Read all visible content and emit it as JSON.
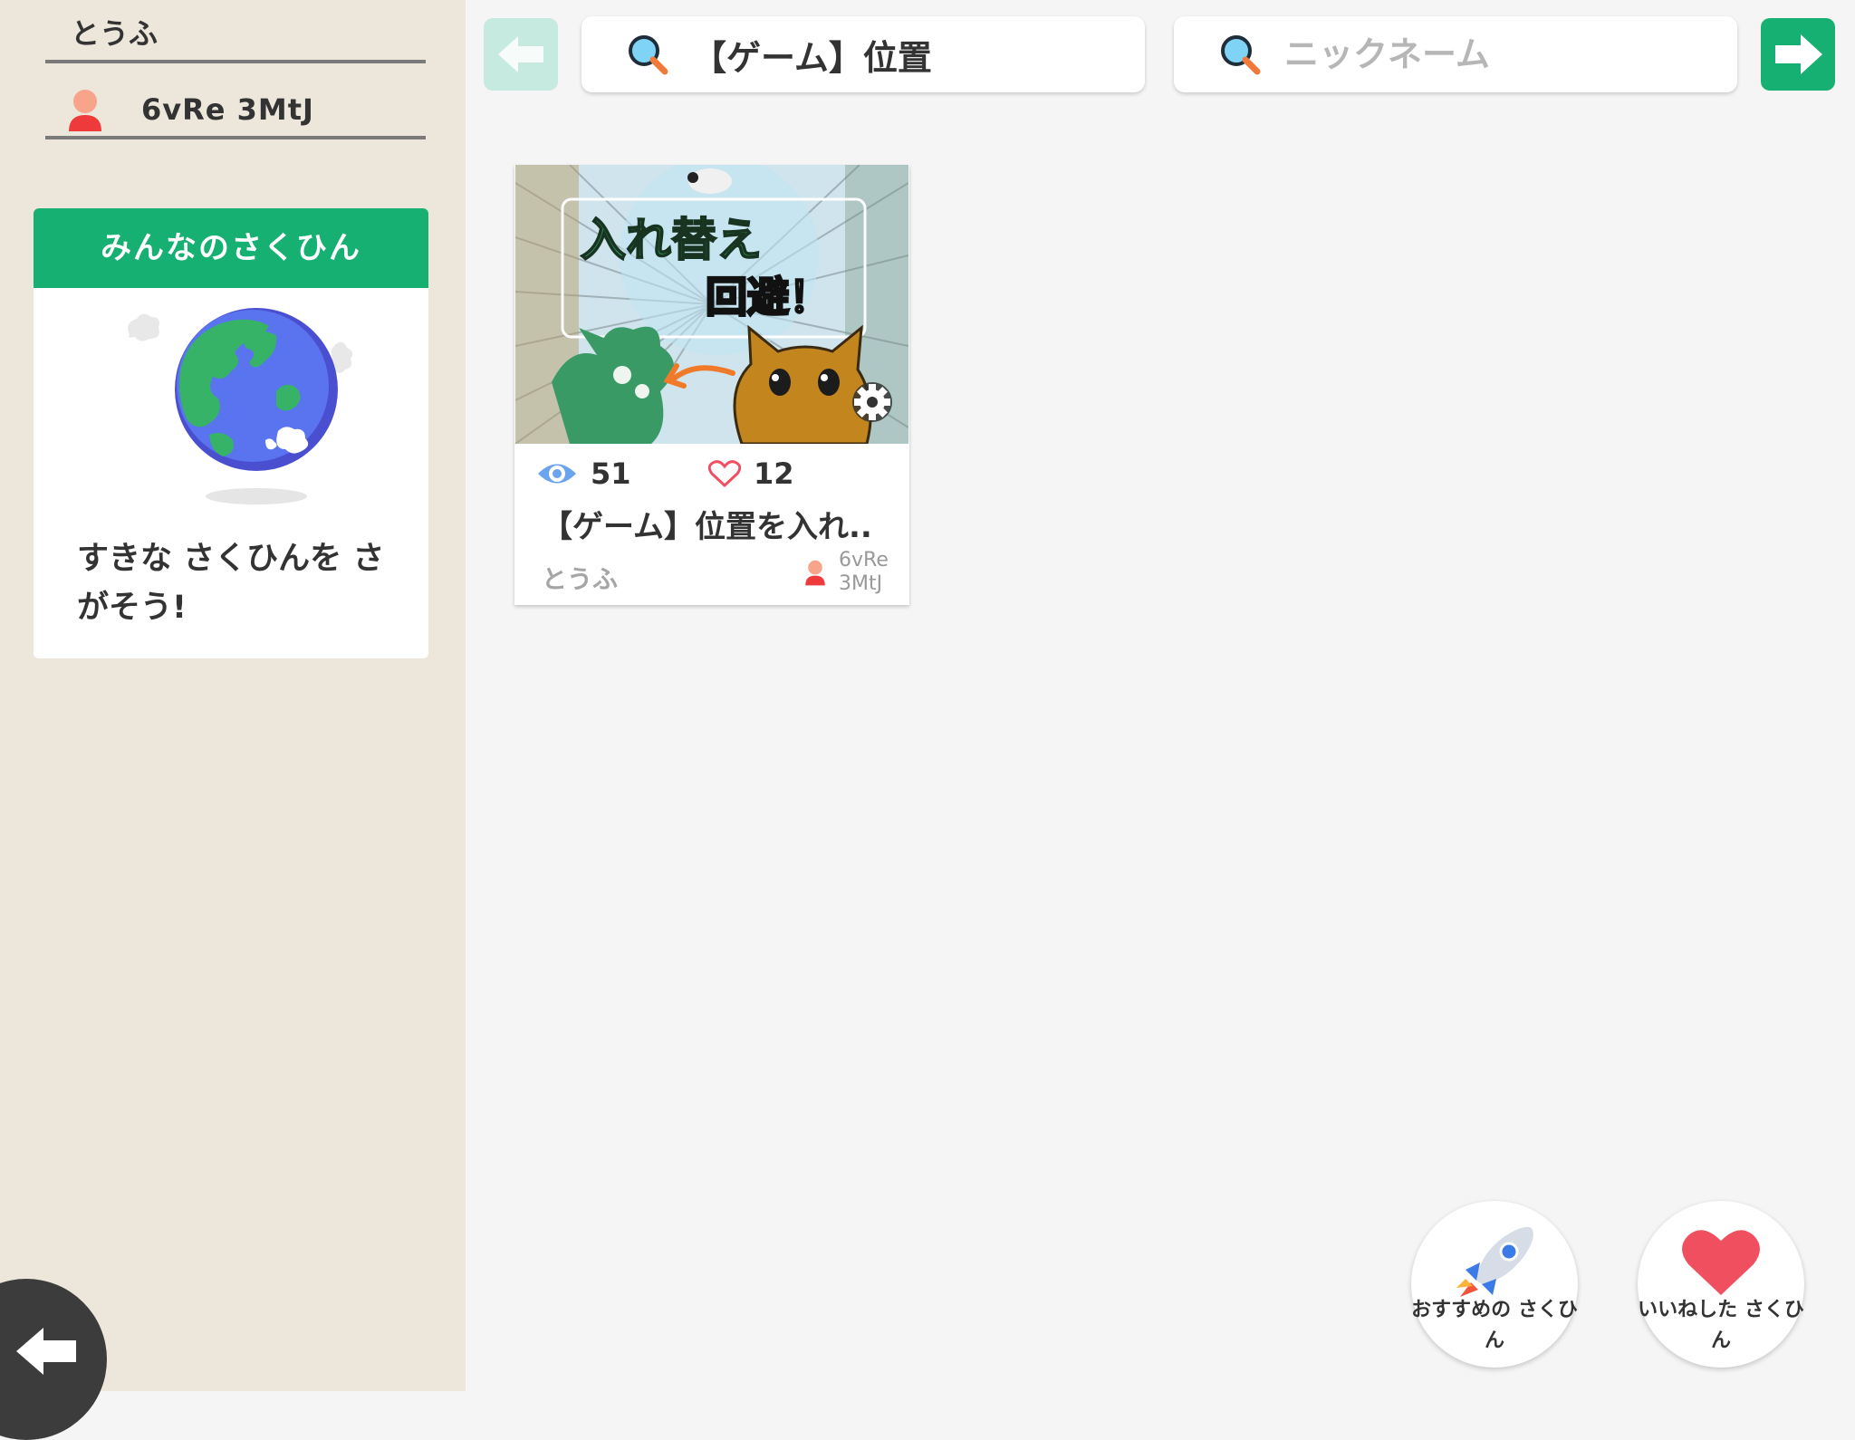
{
  "sidebar": {
    "user_name": "とうふ",
    "user_id": "6vRe 3MtJ",
    "everyone_card": {
      "header": "みんなのさくひん",
      "text": "すきな さくひんを さがそう!"
    }
  },
  "search": {
    "query": "【ゲーム】位置",
    "nickname_placeholder": "ニックネーム"
  },
  "works": [
    {
      "views": "51",
      "likes": "12",
      "title": "【ゲーム】位置を入れ..",
      "author": "とうふ",
      "user_id": "6vRe 3MtJ",
      "thumbnail_text_1": "入れ替え",
      "thumbnail_text_2": "回避！"
    }
  ],
  "bottom_buttons": {
    "recommend_label": "おすすめの さくひん",
    "liked_label": "いいねした さくひん"
  },
  "colors": {
    "accent": "#16b072",
    "sidebar_bg": "#ede6db",
    "heart": "#f04f5f"
  }
}
